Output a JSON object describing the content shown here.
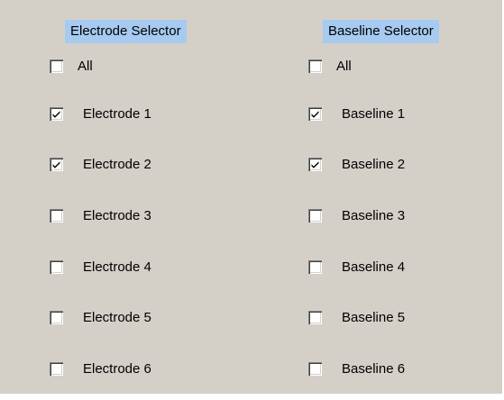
{
  "electrode": {
    "header": "Electrode Selector",
    "items": [
      {
        "label": "All",
        "checked": false
      },
      {
        "label": "Electrode 1",
        "checked": true
      },
      {
        "label": "Electrode 2",
        "checked": true
      },
      {
        "label": "Electrode 3",
        "checked": false
      },
      {
        "label": "Electrode 4",
        "checked": false
      },
      {
        "label": "Electrode 5",
        "checked": false
      },
      {
        "label": "Electrode 6",
        "checked": false
      }
    ]
  },
  "baseline": {
    "header": "Baseline Selector",
    "items": [
      {
        "label": "All",
        "checked": false
      },
      {
        "label": "Baseline 1",
        "checked": true
      },
      {
        "label": "Baseline 2",
        "checked": true
      },
      {
        "label": "Baseline 3",
        "checked": false
      },
      {
        "label": "Baseline 4",
        "checked": false
      },
      {
        "label": "Baseline 5",
        "checked": false
      },
      {
        "label": "Baseline 6",
        "checked": false
      }
    ]
  },
  "colors": {
    "panel_background": "#d4d0c8",
    "header_highlight": "#a6caf0"
  }
}
